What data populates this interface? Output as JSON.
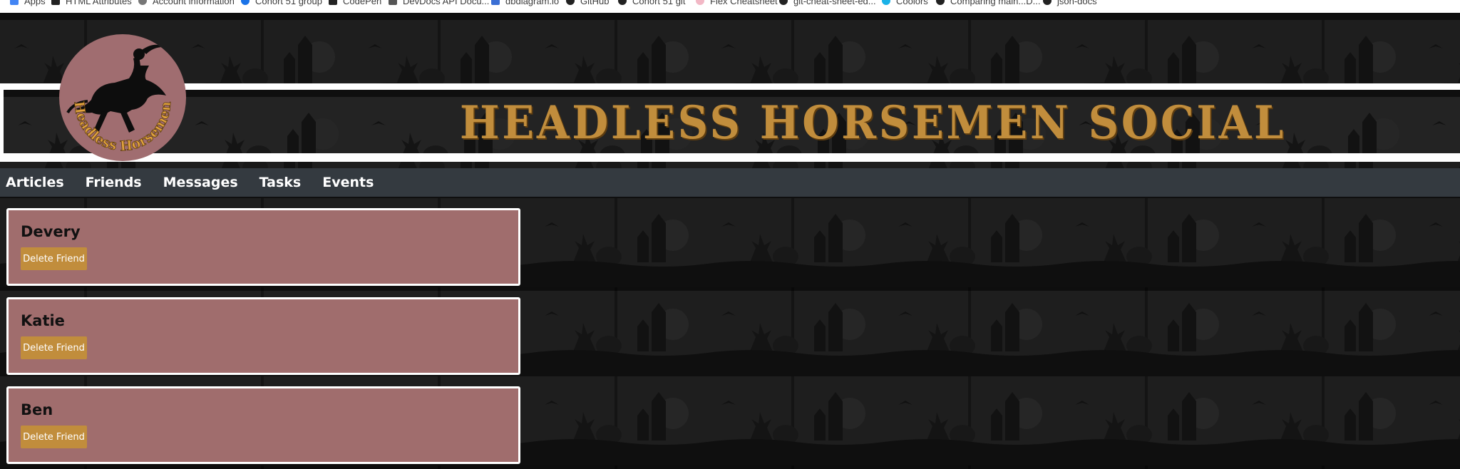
{
  "bookmarks": [
    {
      "label": "Apps",
      "icon": "apps-grid-icon",
      "color": "#4285f4"
    },
    {
      "label": "HTML Attributes",
      "icon": "bookmark-icon",
      "color": "#222222"
    },
    {
      "label": "Account information",
      "icon": "gear-icon",
      "color": "#666666"
    },
    {
      "label": "Cohort 51 group",
      "icon": "people-icon",
      "color": "#1a73e8"
    },
    {
      "label": "CodePen",
      "icon": "codepen-icon",
      "color": "#222222"
    },
    {
      "label": "DevDocs API Docu...",
      "icon": "devdocs-icon",
      "color": "#555555"
    },
    {
      "label": "dbdiagram.io",
      "icon": "dbdiagram-icon",
      "color": "#3b6fd4"
    },
    {
      "label": "GitHub",
      "icon": "github-icon",
      "color": "#222222"
    },
    {
      "label": "Cohort 51 git",
      "icon": "github-icon",
      "color": "#222222"
    },
    {
      "label": "Flex Cheatsheet",
      "icon": "flex-icon",
      "color": "#f2b8c6"
    },
    {
      "label": "git-cheat-sheet-ed...",
      "icon": "github-icon",
      "color": "#222222"
    },
    {
      "label": "Coolors",
      "icon": "coolors-icon",
      "color": "#1ab2e8"
    },
    {
      "label": "Comparing main...D...",
      "icon": "github-icon",
      "color": "#222222"
    },
    {
      "label": "json-docs",
      "icon": "github-icon",
      "color": "#222222"
    }
  ],
  "site": {
    "title": "Headless Horsemen Social",
    "logo_text": "Headless Horsemen",
    "accent_color": "#c18d3c",
    "card_color": "#a06d6d",
    "nav_color": "#343a40"
  },
  "nav": {
    "items": [
      "Articles",
      "Friends",
      "Messages",
      "Tasks",
      "Events"
    ]
  },
  "friends": [
    {
      "name": "Devery",
      "button": "Delete Friend"
    },
    {
      "name": "Katie",
      "button": "Delete Friend"
    },
    {
      "name": "Ben",
      "button": "Delete Friend"
    }
  ]
}
